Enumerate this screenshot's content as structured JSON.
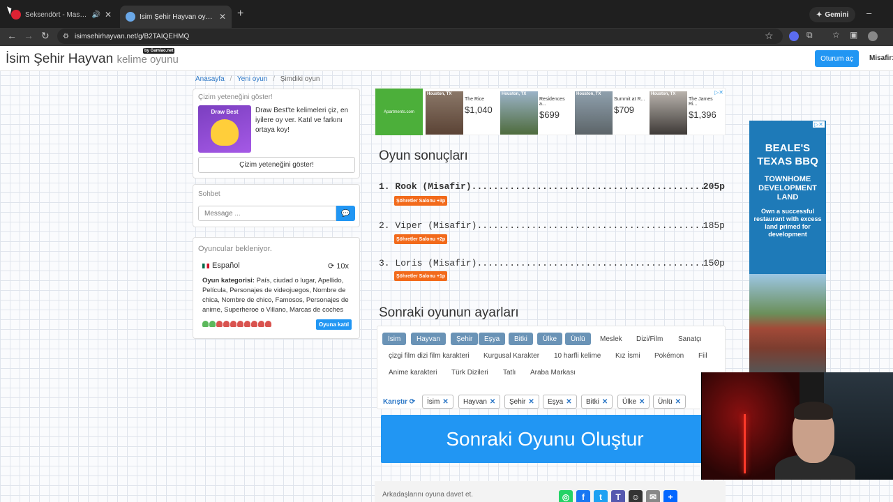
{
  "browser": {
    "tabs": [
      {
        "title": "Seksendört - Masum Değil",
        "active": false
      },
      {
        "title": "İsim Şehir Hayvan oyununa katıl",
        "active": true
      }
    ],
    "url": "isimsehirhayvan.net/g/B2TAIQEHMQ",
    "gemini_label": "Gemini"
  },
  "site": {
    "title": "İsim Şehir Hayvan",
    "subtitle": "kelime oyunu",
    "byline": "by Gamiao.net",
    "login_label": "Oturum aç",
    "guest_label": "Misafir:"
  },
  "breadcrumb": {
    "home": "Anasayfa",
    "new_game": "Yeni oyun",
    "current": "Şimdiki oyun"
  },
  "promo": {
    "title": "Çizim yeteneğini göster!",
    "image_label": "Draw Best",
    "text": "Draw Best'te kelimeleri çiz, en iyilere oy ver. Katıl ve farkını ortaya koy!",
    "button": "Çizim yeteneğini göster!"
  },
  "chat": {
    "title": "Sohbet",
    "placeholder": "Message ..."
  },
  "waiting": {
    "title": "Oyuncular bekleniyor.",
    "language": "Español",
    "rounds": "10x",
    "categories_label": "Oyun kategorisi:",
    "categories": "País, ciudad o lugar, Apellido, Película, Personajes de videojuegos, Nombre de chica, Nombre de chico, Famosos, Personajes de anime, Superheroe o Villano, Marcas de coches",
    "players_joined": 2,
    "players_total": 10,
    "join_label": "Oyuna katıl"
  },
  "ad_strip": {
    "brand": "Apartments.com",
    "items": [
      {
        "city": "Houston, TX",
        "name": "The Rice",
        "price": "$1,040"
      },
      {
        "city": "Houston, TX",
        "name": "Residences a...",
        "price": "$699"
      },
      {
        "city": "Houston, TX",
        "name": "Summit at R...",
        "price": "$709"
      },
      {
        "city": "Houston, TX",
        "name": "The James Ri...",
        "price": "$1,396"
      }
    ]
  },
  "results": {
    "heading": "Oyun sonuçları",
    "entries": [
      {
        "rank": "1.",
        "name": "Rook (Misafir)",
        "score": "205p",
        "badge": "Şöhretler Salonu +3p"
      },
      {
        "rank": "2.",
        "name": "Viper (Misafir)",
        "score": "185p",
        "badge": "Şöhretler Salonu +2p"
      },
      {
        "rank": "3.",
        "name": "Loris (Misafir)",
        "score": "150p",
        "badge": "Şöhretler Salonu +1p"
      }
    ]
  },
  "settings": {
    "heading": "Sonraki oyunun ayarları",
    "categories_row1": [
      {
        "label": "İsim",
        "on": true
      },
      {
        "label": "Hayvan",
        "on": true
      },
      {
        "label": "Şehir",
        "on": true
      },
      {
        "label": "Eşya",
        "on": true
      },
      {
        "label": "Bitki",
        "on": true
      },
      {
        "label": "Ülke",
        "on": true
      },
      {
        "label": "Ünlü",
        "on": true
      },
      {
        "label": "Meslek",
        "on": false
      },
      {
        "label": "Dizi/Film",
        "on": false
      },
      {
        "label": "Sanatçı",
        "on": false
      }
    ],
    "categories_row2": [
      "çizgi film dizi film karakteri",
      "Kurgusal Karakter",
      "10 harfli kelime",
      "Kız İsmi",
      "Pokémon",
      "Fiil"
    ],
    "categories_row3": [
      "Anime karakteri",
      "Türk Dizileri",
      "Tatlı",
      "Araba Markası"
    ],
    "shuffle_label": "Karıştır",
    "selected": [
      "İsim",
      "Hayvan",
      "Şehir",
      "Eşya",
      "Bitki",
      "Ülke",
      "Ünlü"
    ],
    "create_label": "Sonraki Oyunu Oluştur"
  },
  "invite": {
    "text": "Arkadaşlarını oyuna davet et."
  },
  "side_ad": {
    "title": "BEALE'S TEXAS BBQ",
    "subtitle": "TOWNHOME DEVELOPMENT LAND",
    "text": "Own a successful restaurant with excess land primed for development"
  }
}
